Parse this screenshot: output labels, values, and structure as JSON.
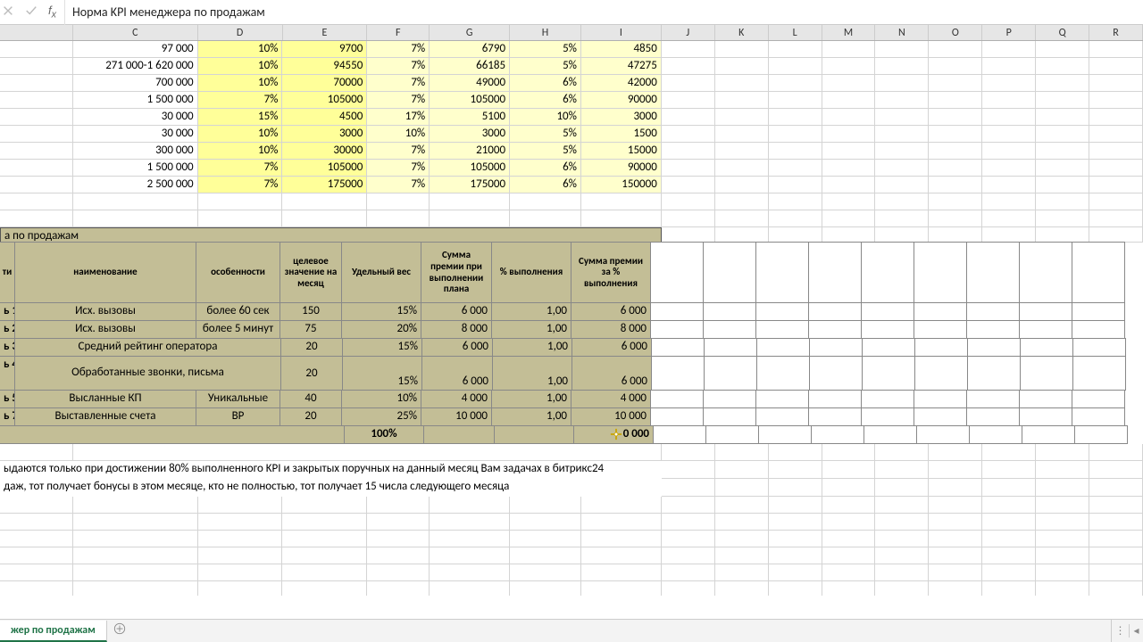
{
  "formula_bar": {
    "value": "Норма KPI менеджера по продажам"
  },
  "columns": [
    "C",
    "D",
    "E",
    "F",
    "G",
    "H",
    "I",
    "J",
    "K",
    "L",
    "M",
    "N",
    "O",
    "P",
    "Q",
    "R"
  ],
  "upper_rows": [
    {
      "C": "97 000",
      "D": "10%",
      "E": "9700",
      "F": "7%",
      "G": "6790",
      "H": "5%",
      "I": "4850"
    },
    {
      "C": "271 000-1 620 000",
      "D": "10%",
      "E": "94550",
      "F": "7%",
      "G": "66185",
      "H": "5%",
      "I": "47275"
    },
    {
      "C": "700 000",
      "D": "10%",
      "E": "70000",
      "F": "7%",
      "G": "49000",
      "H": "6%",
      "I": "42000"
    },
    {
      "C": "1 500 000",
      "D": "7%",
      "E": "105000",
      "F": "7%",
      "G": "105000",
      "H": "6%",
      "I": "90000"
    },
    {
      "C": "30 000",
      "D": "15%",
      "E": "4500",
      "F": "17%",
      "G": "5100",
      "H": "10%",
      "I": "3000"
    },
    {
      "C": "30 000",
      "D": "10%",
      "E": "3000",
      "F": "10%",
      "G": "3000",
      "H": "5%",
      "I": "1500"
    },
    {
      "C": "300 000",
      "D": "10%",
      "E": "30000",
      "F": "7%",
      "G": "21000",
      "H": "5%",
      "I": "15000"
    },
    {
      "C": "1 500 000",
      "D": "7%",
      "E": "105000",
      "F": "7%",
      "G": "105000",
      "H": "6%",
      "I": "90000"
    },
    {
      "C": "2 500 000",
      "D": "7%",
      "E": "175000",
      "F": "7%",
      "G": "175000",
      "H": "6%",
      "I": "150000"
    }
  ],
  "kpi_title": "а по продажам",
  "kpi_headers": {
    "row_label": "ти",
    "name": "наименование",
    "feat": "особенности",
    "target": "целевое значение на месяц",
    "weight": "Удельный вес",
    "bonus_plan": "Сумма премии при выполнении плана",
    "pct": "% выполнения",
    "bonus_pct": "Сумма премии за % выполнения"
  },
  "kpi_rows": [
    {
      "lbl": "ь 1",
      "name": "Исх. вызовы",
      "feat": "более 60 сек",
      "tgt": "150",
      "wt": "15%",
      "bp": "6 000",
      "pct": "1,00",
      "bp2": "6 000"
    },
    {
      "lbl": "ь 2",
      "name": "Исх. вызовы",
      "feat": "более 5 минут",
      "tgt": "75",
      "wt": "20%",
      "bp": "8 000",
      "pct": "1,00",
      "bp2": "8 000"
    },
    {
      "lbl": "ь 3",
      "name": "Средний рейтинг оператора",
      "feat": "",
      "tgt": "20",
      "wt": "15%",
      "bp": "6 000",
      "pct": "1,00",
      "bp2": "6 000",
      "merge_name_feat": true
    },
    {
      "lbl": "ь 4",
      "name": "Обработанные звонки, письма",
      "feat": "",
      "tgt": "20",
      "wt": "15%",
      "bp": "6 000",
      "pct": "1,00",
      "bp2": "6 000",
      "tall": true,
      "merge_name_feat": true
    },
    {
      "lbl": "ь 5",
      "name": "Высланные КП",
      "feat": "Уникальные",
      "tgt": "40",
      "wt": "10%",
      "bp": "4 000",
      "pct": "1,00",
      "bp2": "4 000"
    },
    {
      "lbl": "ь 7",
      "name": "Выставленные счета",
      "feat": "ВР",
      "tgt": "20",
      "wt": "25%",
      "bp": "10 000",
      "pct": "1,00",
      "bp2": "10 000"
    }
  ],
  "kpi_total": {
    "wt": "100%",
    "sum_label": "0 000"
  },
  "notes": [
    "ыдаются только при достижении 80% выполненного KPI и закрытых поручных на данный месяц Вам задачах в битрикс24",
    "даж, тот получает бонусы в этом месяце, кто не полностью, тот получает 15 числа следующего месяца"
  ],
  "sheet_tab": "жер по продажам"
}
